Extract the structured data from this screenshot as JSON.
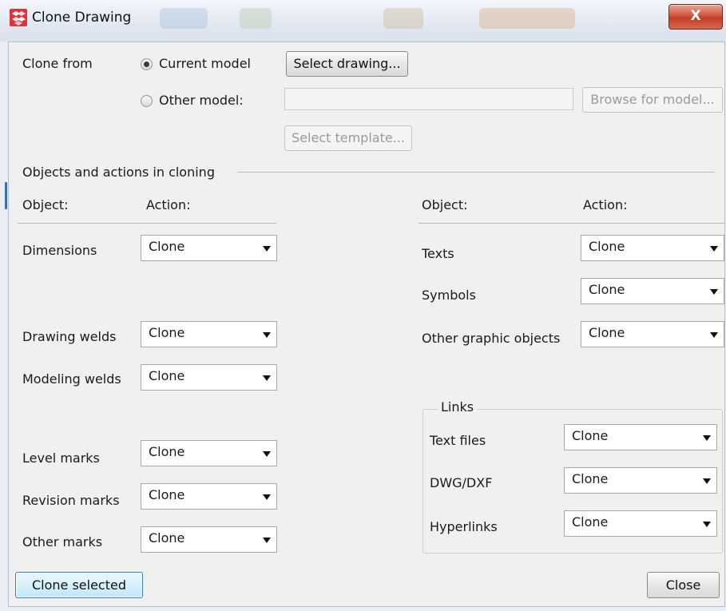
{
  "window": {
    "title": "Clone Drawing",
    "close_glyph": "X",
    "app_icon": "tekla-logo-icon"
  },
  "clone_from": {
    "label": "Clone from",
    "current_model": "Current model",
    "other_model": "Other model:",
    "select_drawing": "Select drawing...",
    "browse_for_model": "Browse for model...",
    "select_template": "Select template...",
    "other_model_path": ""
  },
  "section_title": "Objects and actions in cloning",
  "headers": {
    "object": "Object:",
    "action": "Action:"
  },
  "left_objects": [
    {
      "label": "Dimensions",
      "action": "Clone"
    },
    {
      "label": "Drawing welds",
      "action": "Clone"
    },
    {
      "label": "Modeling welds",
      "action": "Clone"
    },
    {
      "label": "Level marks",
      "action": "Clone"
    },
    {
      "label": "Revision marks",
      "action": "Clone"
    },
    {
      "label": "Other marks",
      "action": "Clone"
    }
  ],
  "right_objects": [
    {
      "label": "Texts",
      "action": "Clone"
    },
    {
      "label": "Symbols",
      "action": "Clone"
    },
    {
      "label": "Other graphic objects",
      "action": "Clone"
    }
  ],
  "links": {
    "title": "Links",
    "items": [
      {
        "label": "Text files",
        "action": "Clone"
      },
      {
        "label": "DWG/DXF",
        "action": "Clone"
      },
      {
        "label": "Hyperlinks",
        "action": "Clone"
      }
    ]
  },
  "footer": {
    "clone_selected": "Clone selected",
    "close": "Close"
  }
}
